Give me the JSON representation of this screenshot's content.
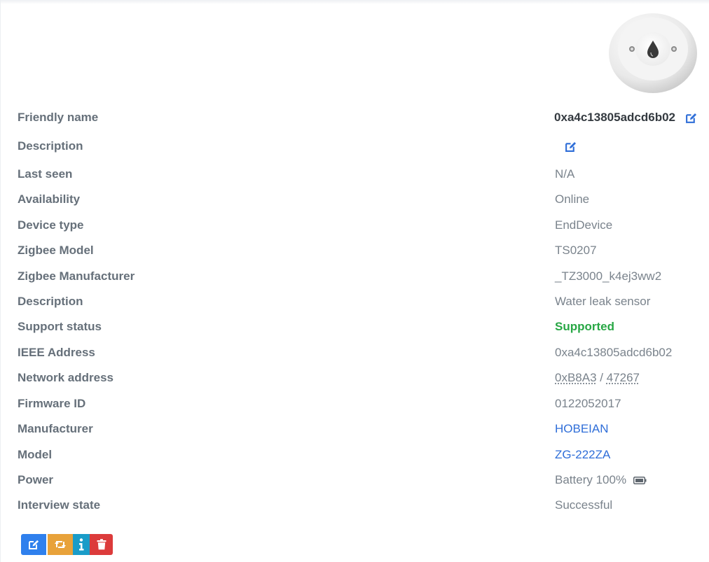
{
  "device": {
    "image_icon": "water-drop-icon",
    "rows": [
      {
        "label": "Friendly name",
        "value": "0xa4c13805adcd6b02"
      },
      {
        "label": "Description",
        "value": ""
      },
      {
        "label": "Last seen",
        "value": "N/A"
      },
      {
        "label": "Availability",
        "value": "Online"
      },
      {
        "label": "Device type",
        "value": "EndDevice"
      },
      {
        "label": "Zigbee Model",
        "value": "TS0207"
      },
      {
        "label": "Zigbee Manufacturer",
        "value": "_TZ3000_k4ej3ww2"
      },
      {
        "label": "Description",
        "value": "Water leak sensor"
      },
      {
        "label": "Support status",
        "value": "Supported"
      },
      {
        "label": "IEEE Address",
        "value": "0xa4c13805adcd6b02"
      },
      {
        "label": "Network address",
        "value_hex": "0xB8A3",
        "separator": " / ",
        "value_dec": "47267"
      },
      {
        "label": "Firmware ID",
        "value": "0122052017"
      },
      {
        "label": "Manufacturer",
        "value": "HOBEIAN"
      },
      {
        "label": "Model",
        "value": "ZG-222ZA"
      },
      {
        "label": "Power",
        "value": "Battery 100%",
        "icon": "battery-full-icon"
      },
      {
        "label": "Interview state",
        "value": "Successful"
      }
    ]
  },
  "actions": [
    {
      "name": "rename-button",
      "icon": "edit-icon",
      "color": "#2f80ed"
    },
    {
      "name": "reconfigure-button",
      "icon": "retweet-icon",
      "color": "#e8a23a"
    },
    {
      "name": "interview-button",
      "icon": "info-icon",
      "color": "#1a9cc8"
    },
    {
      "name": "remove-button",
      "icon": "trash-icon",
      "color": "#dc3b3b"
    }
  ],
  "colors": {
    "label": "#66707a",
    "value": "#7a838c",
    "link": "#2f6ed8",
    "supported": "#28a745"
  }
}
